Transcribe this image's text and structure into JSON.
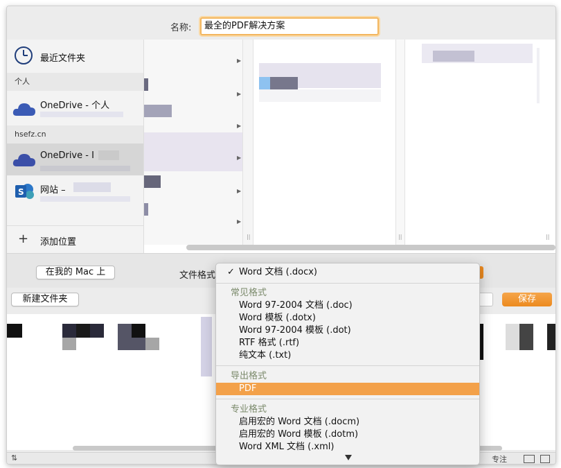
{
  "dialog": {
    "name_label": "名称:",
    "name_value": "最全的PDF解决方案"
  },
  "sidebar": {
    "recent_label": "最近文件夹",
    "section_personal": "个人",
    "onedrive_personal_title": "OneDrive - 个人",
    "section_org": "hsefz.cn",
    "onedrive_org_title": "OneDrive - I",
    "site_title": "网站 –",
    "add_location_label": "添加位置",
    "add_icon": "+"
  },
  "options": {
    "on_my_mac_label": "在我的 Mac 上",
    "file_format_label": "文件格式",
    "new_folder_label": "新建文件夹",
    "save_label": "保存"
  },
  "format_menu": {
    "selected_item": "Word 文档 (.docx)",
    "group_common": "常见格式",
    "common_items": [
      "Word 97-2004 文档 (.doc)",
      "Word 模板 (.dotx)",
      "Word 97-2004 模板 (.dot)",
      "RTF 格式 (.rtf)",
      "纯文本 (.txt)"
    ],
    "group_export": "导出格式",
    "export_items": [
      "PDF"
    ],
    "group_special": "专业格式",
    "special_items": [
      "启用宏的 Word 文档 (.docm)",
      "启用宏的 Word 模板 (.dotm)",
      "Word XML 文档 (.xml)"
    ],
    "highlight_color": "#F3A14A"
  },
  "status": {
    "focus_label": "专注"
  },
  "icons": {
    "recent": "clock-icon",
    "onedrive": "cloud-icon",
    "sharepoint": "sharepoint-icon",
    "check": "checkmark-icon"
  }
}
